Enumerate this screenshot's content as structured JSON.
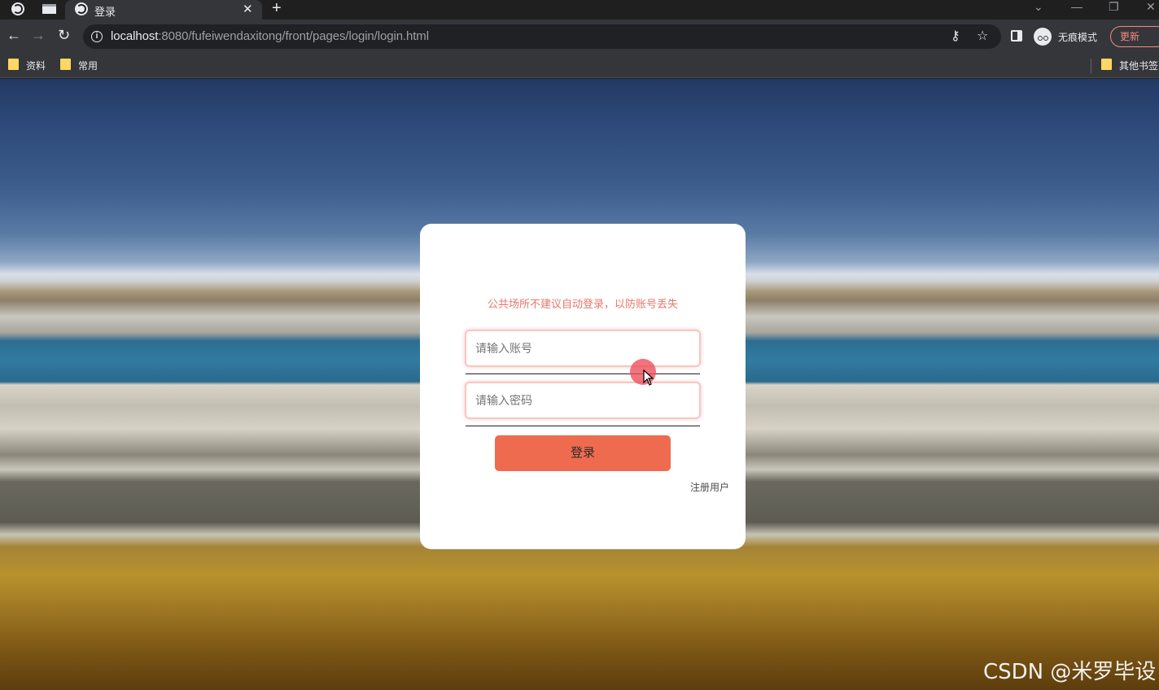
{
  "browser": {
    "tab_title": "登录",
    "url_host": "localhost",
    "url_rest": ":8080/fufeiwendaxitong/front/pages/login/login.html",
    "incognito_label": "无痕模式",
    "update_label": "更新",
    "bookmarks": [
      "资料",
      "常用"
    ],
    "other_bookmarks": "其他书签"
  },
  "login": {
    "notice": "公共场所不建议自动登录，以防账号丢失",
    "account_placeholder": "请输入账号",
    "password_placeholder": "请输入密码",
    "login_button": "登录",
    "register_link": "注册用户"
  },
  "watermark": "CSDN @米罗毕设",
  "colors": {
    "accent": "#ef6b4f",
    "notice_text": "#e8776a",
    "field_border": "#f9c6c1"
  }
}
